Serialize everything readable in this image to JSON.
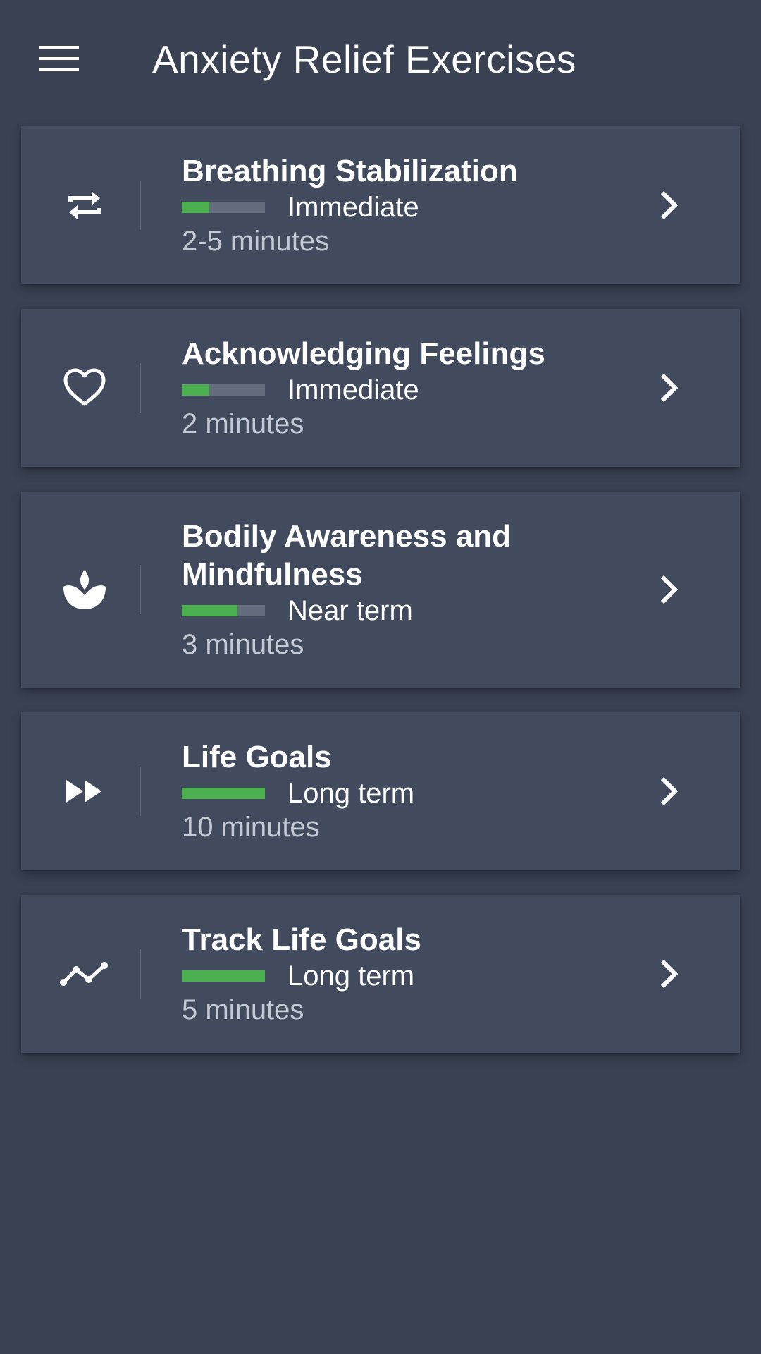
{
  "app_bar": {
    "title": "Anxiety Relief Exercises",
    "menu_icon": "hamburger-menu-icon"
  },
  "colors": {
    "background": "#394153",
    "card": "#414b5d",
    "progress_fill": "#4caf50",
    "progress_track": "#646d7d",
    "duration_text": "#c4c9d3"
  },
  "exercises": [
    {
      "title": "Breathing Stabilization",
      "icon": "repeat-arrows-icon",
      "term": "Immediate",
      "term_level": 0.33,
      "duration": "2-5 minutes"
    },
    {
      "title": "Acknowledging Feelings",
      "icon": "heart-outline-icon",
      "term": "Immediate",
      "term_level": 0.33,
      "duration": "2 minutes"
    },
    {
      "title": "Bodily Awareness and Mindfulness",
      "icon": "lotus-icon",
      "term": "Near term",
      "term_level": 0.67,
      "duration": "3 minutes"
    },
    {
      "title": "Life Goals",
      "icon": "fast-forward-icon",
      "term": "Long term",
      "term_level": 1.0,
      "duration": "10 minutes"
    },
    {
      "title": "Track Life Goals",
      "icon": "trend-line-icon",
      "term": "Long term",
      "term_level": 1.0,
      "duration": "5 minutes"
    }
  ]
}
